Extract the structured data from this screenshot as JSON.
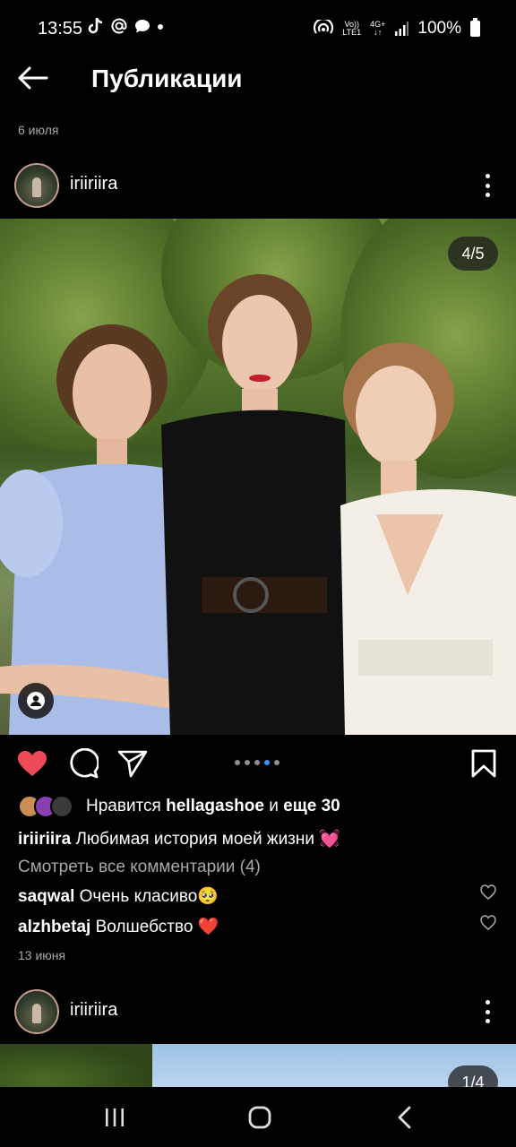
{
  "status_bar": {
    "time": "13:55",
    "network_top": "Vo))",
    "network_bottom": "LTE1",
    "net_type": "4G+",
    "battery": "100%"
  },
  "header": {
    "title": "Публикации"
  },
  "date_top": "6 июля",
  "post": {
    "username": "iriiriira",
    "photo_counter": "4/5",
    "likes_prefix": "Нравится",
    "likes_user": "hellagashoe",
    "likes_and": "и",
    "likes_more": "еще 30",
    "caption_user": "iriiriira",
    "caption_text": "Любимая история моей жизни 💓",
    "view_comments": "Смотреть все комментарии (4)",
    "comments": [
      {
        "user": "saqwal",
        "text": "Очень класиво🥺"
      },
      {
        "user": "alzhbetaj",
        "text": "Волшебство ❤️"
      }
    ],
    "date": "13 июня",
    "carousel_active": 3,
    "carousel_total": 5
  },
  "next_post": {
    "username": "iriiriira",
    "photo_counter": "1/4"
  },
  "colors": {
    "like_red": "#ed4956",
    "dot_active": "#3897f0",
    "muted_text": "#a8a8a8"
  },
  "icons": [
    "back-arrow-icon",
    "more-icon",
    "heart-icon",
    "comment-icon",
    "share-icon",
    "bookmark-icon",
    "user-tag-icon",
    "comment-like-icon",
    "recents-icon",
    "home-icon",
    "nav-back-icon"
  ]
}
